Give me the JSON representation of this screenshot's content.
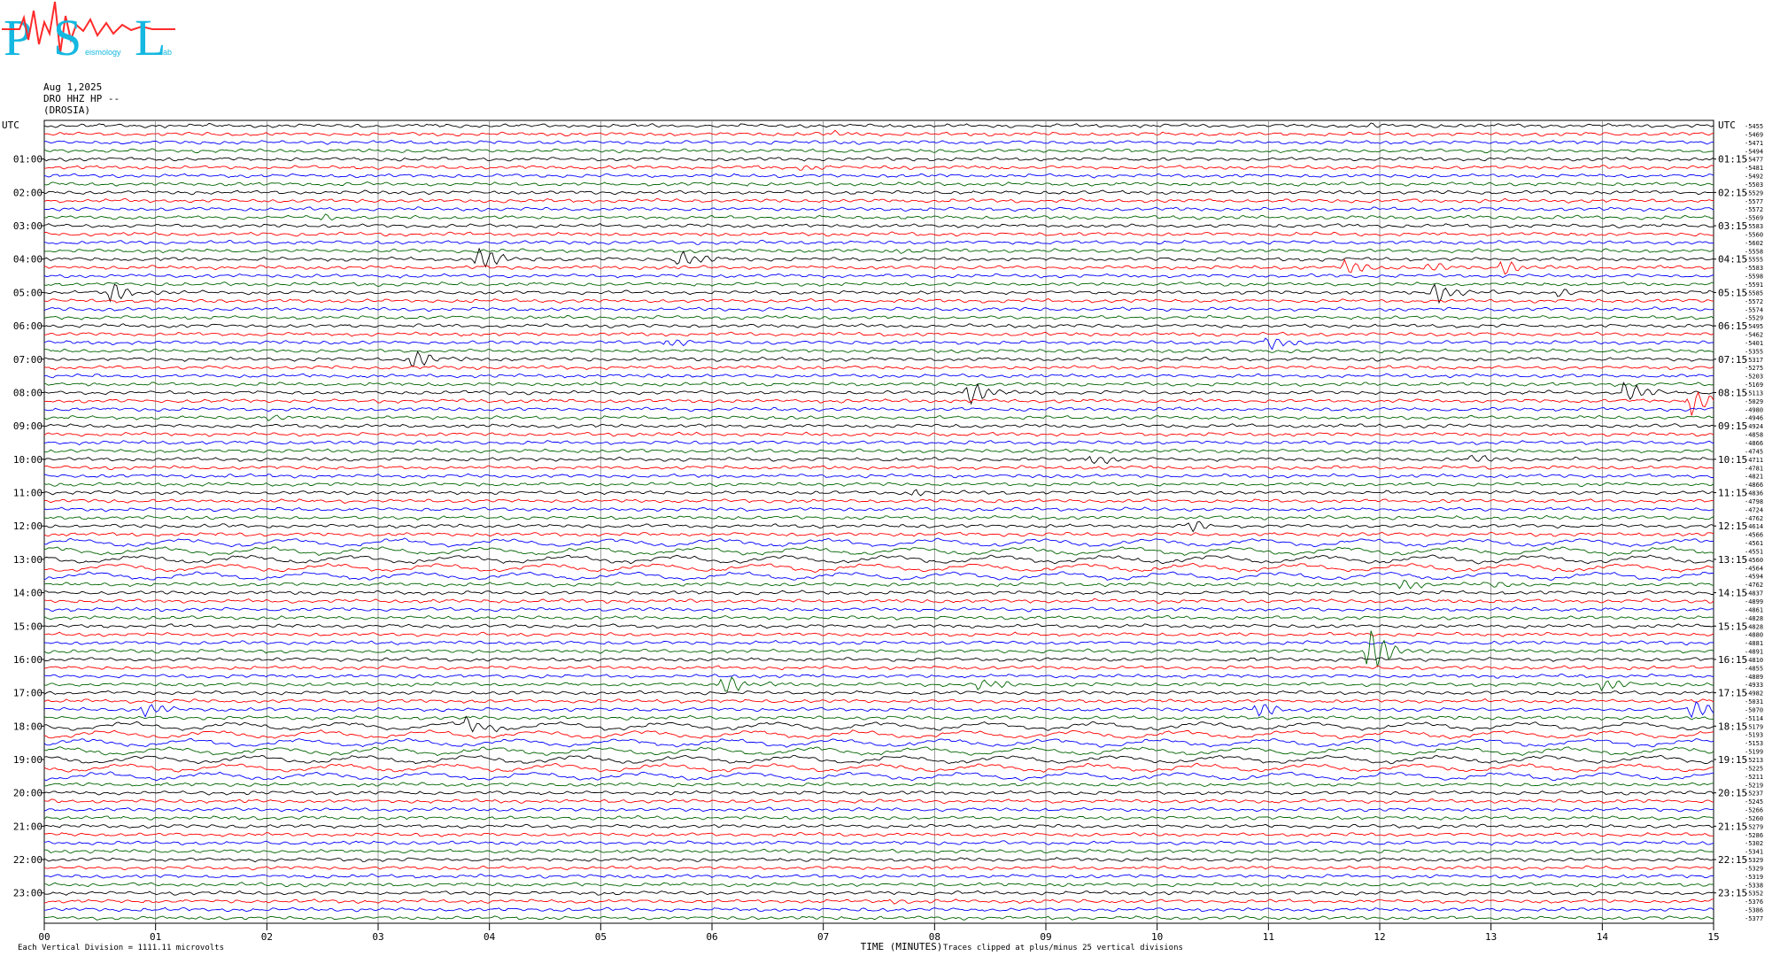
{
  "logo": {
    "letters": [
      "P",
      "S",
      "L"
    ],
    "tagline_parts": [
      "",
      "eismology",
      "ab"
    ],
    "colors": {
      "blue": "#14b8e0",
      "red": "#ff2b2b"
    }
  },
  "header": {
    "date": "Aug 1,2025",
    "station": "DRO HHZ HP --",
    "location": "(DROSIA)"
  },
  "footer": {
    "scale_note": "Each Vertical Division = 1111.11 microvolts",
    "xlabel": "TIME (MINUTES)",
    "clip_note": "Traces clipped at plus/minus 25 vertical divisions"
  },
  "colors": {
    "trace_cycle": [
      "#000000",
      "#ff0000",
      "#0000ff",
      "#006400"
    ],
    "grid": "#808080"
  },
  "chart_data": {
    "type": "line",
    "subtype": "helicorder",
    "title": "",
    "xlabel": "TIME (MINUTES)",
    "ylabel": "",
    "x_range": [
      0,
      15
    ],
    "x_ticks": [
      "00",
      "01",
      "02",
      "03",
      "04",
      "05",
      "06",
      "07",
      "08",
      "09",
      "10",
      "11",
      "12",
      "13",
      "14",
      "15"
    ],
    "left_axis_label": "UTC",
    "right_axis_label": "UTC",
    "left_hour_labels": [
      "01:00",
      "02:00",
      "03:00",
      "04:00",
      "05:00",
      "06:00",
      "07:00",
      "08:00",
      "09:00",
      "10:00",
      "11:00",
      "12:00",
      "13:00",
      "14:00",
      "15:00",
      "16:00",
      "17:00",
      "18:00",
      "19:00",
      "20:00",
      "21:00",
      "22:00",
      "23:00"
    ],
    "right_hour_labels": [
      "01:15",
      "02:15",
      "03:15",
      "04:15",
      "05:15",
      "06:15",
      "07:15",
      "08:15",
      "09:15",
      "10:15",
      "11:15",
      "12:15",
      "13:15",
      "14:15",
      "15:15",
      "16:15",
      "17:15",
      "18:15",
      "19:15",
      "20:15",
      "21:15",
      "22:15",
      "23:15"
    ],
    "trace_count": 96,
    "trace_minutes": 15,
    "trace_offsets": [
      -5455,
      -5469,
      -5471,
      -5494,
      -5477,
      -5481,
      -5492,
      -5503,
      -5529,
      -5577,
      -5572,
      -5569,
      -5583,
      -5560,
      -5602,
      -5558,
      -5555,
      -5583,
      -5598,
      -5591,
      -5585,
      -5572,
      -5574,
      -5529,
      -5495,
      -5462,
      -5401,
      -5355,
      -5317,
      -5275,
      -5203,
      -5169,
      -5113,
      -5029,
      -4980,
      -4946,
      -4924,
      -4858,
      -4866,
      -4745,
      -4711,
      -4781,
      -4821,
      -4866,
      -4836,
      -4798,
      -4724,
      -4762,
      -4614,
      -4566,
      -4561,
      -4551,
      -4560,
      -4564,
      -4594,
      -4762,
      -4837,
      -4899,
      -4861,
      -4828,
      -4828,
      -4880,
      -4881,
      -4891,
      -4810,
      -4855,
      -4889,
      -4933,
      -4982,
      -5031,
      -5070,
      -5114,
      -5179,
      -5193,
      -5153,
      -5199,
      -5213,
      -5225,
      -5211,
      -5219,
      -5237,
      -5245,
      -5266,
      -5260,
      -5279,
      -5286,
      -5302,
      -5341,
      -5329,
      -5329,
      -5319,
      -5338,
      -5352,
      -5376,
      -5386,
      -5377
    ],
    "events": [
      {
        "row": 0,
        "minute": 11.9,
        "amp": 2
      },
      {
        "row": 1,
        "minute": 7.1,
        "amp": 3
      },
      {
        "row": 5,
        "minute": 6.8,
        "amp": 4
      },
      {
        "row": 11,
        "minute": 2.5,
        "amp": 3
      },
      {
        "row": 15,
        "minute": 7.6,
        "amp": 3
      },
      {
        "row": 16,
        "minute": 3.9,
        "amp": 18
      },
      {
        "row": 16,
        "minute": 5.7,
        "amp": 12
      },
      {
        "row": 17,
        "minute": 11.7,
        "amp": 12
      },
      {
        "row": 17,
        "minute": 12.4,
        "amp": 8
      },
      {
        "row": 17,
        "minute": 13.1,
        "amp": 10
      },
      {
        "row": 20,
        "minute": 0.6,
        "amp": 14
      },
      {
        "row": 20,
        "minute": 12.5,
        "amp": 14
      },
      {
        "row": 20,
        "minute": 13.6,
        "amp": 6
      },
      {
        "row": 26,
        "minute": 5.6,
        "amp": 6
      },
      {
        "row": 26,
        "minute": 11.0,
        "amp": 9
      },
      {
        "row": 28,
        "minute": 3.3,
        "amp": 14
      },
      {
        "row": 32,
        "minute": 8.3,
        "amp": 16
      },
      {
        "row": 32,
        "minute": 14.2,
        "amp": 14
      },
      {
        "row": 33,
        "minute": 14.8,
        "amp": 18
      },
      {
        "row": 35,
        "minute": 2.0,
        "amp": 5
      },
      {
        "row": 40,
        "minute": 9.4,
        "amp": 8
      },
      {
        "row": 40,
        "minute": 12.8,
        "amp": 7
      },
      {
        "row": 44,
        "minute": 7.8,
        "amp": 5
      },
      {
        "row": 48,
        "minute": 10.3,
        "amp": 8
      },
      {
        "row": 55,
        "minute": 12.2,
        "amp": 7
      },
      {
        "row": 55,
        "minute": 13.0,
        "amp": 5
      },
      {
        "row": 63,
        "minute": 11.9,
        "amp": 30
      },
      {
        "row": 67,
        "minute": 6.1,
        "amp": 14
      },
      {
        "row": 67,
        "minute": 8.4,
        "amp": 9
      },
      {
        "row": 67,
        "minute": 14.0,
        "amp": 9
      },
      {
        "row": 70,
        "minute": 0.9,
        "amp": 10
      },
      {
        "row": 70,
        "minute": 10.9,
        "amp": 10
      },
      {
        "row": 70,
        "minute": 14.8,
        "amp": 14
      },
      {
        "row": 72,
        "minute": 3.8,
        "amp": 12
      },
      {
        "row": 93,
        "minute": 7.6,
        "amp": 4
      }
    ]
  }
}
